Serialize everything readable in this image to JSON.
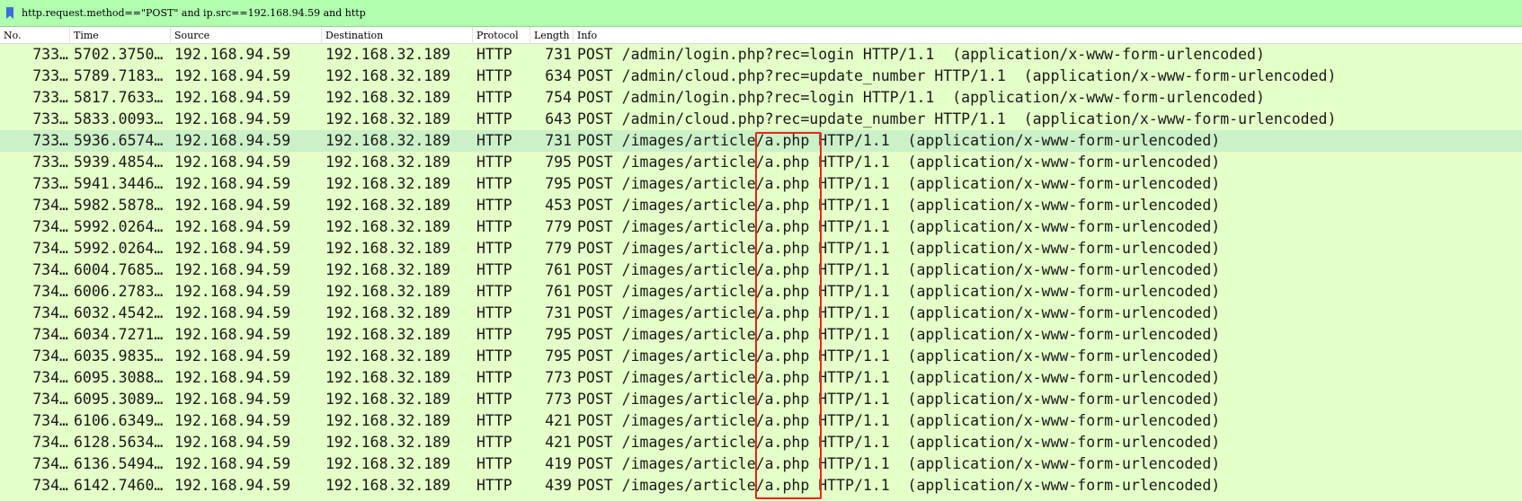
{
  "filter": {
    "expression": "http.request.method==\"POST\" and ip.src==192.168.94.59 and http",
    "icon": "bookmark-icon",
    "color": "#afffaf"
  },
  "columns": [
    "No.",
    "Time",
    "Source",
    "Destination",
    "Protocol",
    "Length",
    "Info"
  ],
  "row_color": "#e4ffc7",
  "highlight_color": "#e8261c",
  "packets": [
    {
      "no": "733…",
      "time": "5702.3750…",
      "src": "192.168.94.59",
      "dst": "192.168.32.189",
      "proto": "HTTP",
      "len": "731",
      "info": "POST /admin/login.php?rec=login HTTP/1.1  (application/x-www-form-urlencoded)"
    },
    {
      "no": "733…",
      "time": "5789.7183…",
      "src": "192.168.94.59",
      "dst": "192.168.32.189",
      "proto": "HTTP",
      "len": "634",
      "info": "POST /admin/cloud.php?rec=update_number HTTP/1.1  (application/x-www-form-urlencoded)"
    },
    {
      "no": "733…",
      "time": "5817.7633…",
      "src": "192.168.94.59",
      "dst": "192.168.32.189",
      "proto": "HTTP",
      "len": "754",
      "info": "POST /admin/login.php?rec=login HTTP/1.1  (application/x-www-form-urlencoded)"
    },
    {
      "no": "733…",
      "time": "5833.0093…",
      "src": "192.168.94.59",
      "dst": "192.168.32.189",
      "proto": "HTTP",
      "len": "643",
      "info": "POST /admin/cloud.php?rec=update_number HTTP/1.1  (application/x-www-form-urlencoded)"
    },
    {
      "no": "733…",
      "time": "5936.6574…",
      "src": "192.168.94.59",
      "dst": "192.168.32.189",
      "proto": "HTTP",
      "len": "731",
      "info": "POST /images/article/a.php HTTP/1.1  (application/x-www-form-urlencoded)",
      "selected": true
    },
    {
      "no": "733…",
      "time": "5939.4854…",
      "src": "192.168.94.59",
      "dst": "192.168.32.189",
      "proto": "HTTP",
      "len": "795",
      "info": "POST /images/article/a.php HTTP/1.1  (application/x-www-form-urlencoded)"
    },
    {
      "no": "733…",
      "time": "5941.3446…",
      "src": "192.168.94.59",
      "dst": "192.168.32.189",
      "proto": "HTTP",
      "len": "795",
      "info": "POST /images/article/a.php HTTP/1.1  (application/x-www-form-urlencoded)"
    },
    {
      "no": "734…",
      "time": "5982.5878…",
      "src": "192.168.94.59",
      "dst": "192.168.32.189",
      "proto": "HTTP",
      "len": "453",
      "info": "POST /images/article/a.php HTTP/1.1  (application/x-www-form-urlencoded)"
    },
    {
      "no": "734…",
      "time": "5992.0264…",
      "src": "192.168.94.59",
      "dst": "192.168.32.189",
      "proto": "HTTP",
      "len": "779",
      "info": "POST /images/article/a.php HTTP/1.1  (application/x-www-form-urlencoded)"
    },
    {
      "no": "734…",
      "time": "5992.0264…",
      "src": "192.168.94.59",
      "dst": "192.168.32.189",
      "proto": "HTTP",
      "len": "779",
      "info": "POST /images/article/a.php HTTP/1.1  (application/x-www-form-urlencoded)"
    },
    {
      "no": "734…",
      "time": "6004.7685…",
      "src": "192.168.94.59",
      "dst": "192.168.32.189",
      "proto": "HTTP",
      "len": "761",
      "info": "POST /images/article/a.php HTTP/1.1  (application/x-www-form-urlencoded)"
    },
    {
      "no": "734…",
      "time": "6006.2783…",
      "src": "192.168.94.59",
      "dst": "192.168.32.189",
      "proto": "HTTP",
      "len": "761",
      "info": "POST /images/article/a.php HTTP/1.1  (application/x-www-form-urlencoded)"
    },
    {
      "no": "734…",
      "time": "6032.4542…",
      "src": "192.168.94.59",
      "dst": "192.168.32.189",
      "proto": "HTTP",
      "len": "731",
      "info": "POST /images/article/a.php HTTP/1.1  (application/x-www-form-urlencoded)"
    },
    {
      "no": "734…",
      "time": "6034.7271…",
      "src": "192.168.94.59",
      "dst": "192.168.32.189",
      "proto": "HTTP",
      "len": "795",
      "info": "POST /images/article/a.php HTTP/1.1  (application/x-www-form-urlencoded)"
    },
    {
      "no": "734…",
      "time": "6035.9835…",
      "src": "192.168.94.59",
      "dst": "192.168.32.189",
      "proto": "HTTP",
      "len": "795",
      "info": "POST /images/article/a.php HTTP/1.1  (application/x-www-form-urlencoded)"
    },
    {
      "no": "734…",
      "time": "6095.3088…",
      "src": "192.168.94.59",
      "dst": "192.168.32.189",
      "proto": "HTTP",
      "len": "773",
      "info": "POST /images/article/a.php HTTP/1.1  (application/x-www-form-urlencoded)"
    },
    {
      "no": "734…",
      "time": "6095.3089…",
      "src": "192.168.94.59",
      "dst": "192.168.32.189",
      "proto": "HTTP",
      "len": "773",
      "info": "POST /images/article/a.php HTTP/1.1  (application/x-www-form-urlencoded)"
    },
    {
      "no": "734…",
      "time": "6106.6349…",
      "src": "192.168.94.59",
      "dst": "192.168.32.189",
      "proto": "HTTP",
      "len": "421",
      "info": "POST /images/article/a.php HTTP/1.1  (application/x-www-form-urlencoded)"
    },
    {
      "no": "734…",
      "time": "6128.5634…",
      "src": "192.168.94.59",
      "dst": "192.168.32.189",
      "proto": "HTTP",
      "len": "421",
      "info": "POST /images/article/a.php HTTP/1.1  (application/x-www-form-urlencoded)"
    },
    {
      "no": "734…",
      "time": "6136.5494…",
      "src": "192.168.94.59",
      "dst": "192.168.32.189",
      "proto": "HTTP",
      "len": "419",
      "info": "POST /images/article/a.php HTTP/1.1  (application/x-www-form-urlencoded)"
    },
    {
      "no": "734…",
      "time": "6142.7460…",
      "src": "192.168.94.59",
      "dst": "192.168.32.189",
      "proto": "HTTP",
      "len": "439",
      "info": "POST /images/article/a.php HTTP/1.1  (application/x-www-form-urlencoded)"
    }
  ]
}
